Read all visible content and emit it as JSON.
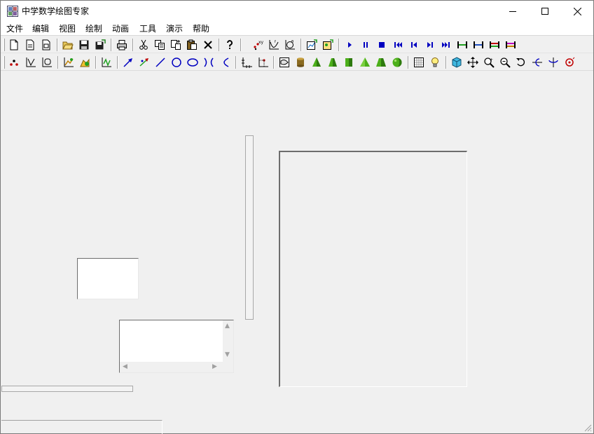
{
  "window": {
    "title": "中学数学绘图专家",
    "minimize_icon": "minimize-icon",
    "maximize_icon": "maximize-icon",
    "close_icon": "close-icon"
  },
  "menu": {
    "items": [
      "文件",
      "编辑",
      "视图",
      "绘制",
      "动画",
      "工具",
      "演示",
      "帮助"
    ]
  },
  "toolbar_top": {
    "icons": [
      "new-icon",
      "new-page-icon",
      "copy-page-icon",
      "open-folder-icon",
      "save-icon",
      "save-as-icon",
      "print-icon",
      "cut-icon",
      "copy-icon",
      "paste-special-icon",
      "paste-icon",
      "delete-icon",
      "help-icon",
      "point-coordinates-icon",
      "function-graph-icon",
      "polar-graph-icon",
      "insert-graph-icon",
      "insert-image-icon",
      "play-icon",
      "pause-icon",
      "stop-icon",
      "first-frame-icon",
      "previous-frame-icon",
      "next-frame-icon",
      "last-frame-icon",
      "interval-a-icon",
      "interval-b-icon",
      "interval-c-icon",
      "interval-d-icon"
    ]
  },
  "toolbar_draw": {
    "icons": [
      "points-icon",
      "axes-icon",
      "axes-box-icon",
      "function-plot-icon",
      "function-area-icon",
      "select-graph-icon",
      "vector-arrow-icon",
      "color-vector-icon",
      "line-segment-icon",
      "circle-icon",
      "ellipse-icon",
      "hyperbola-icon",
      "parabola-icon",
      "coordinate-axes-icon",
      "point-axes-icon",
      "surface-box-icon",
      "cylinder-icon",
      "cone-icon",
      "frustum-icon",
      "prism-icon",
      "pyramid-icon",
      "truncated-pyramid-icon",
      "sphere-icon",
      "grid-icon",
      "light-bulb-icon",
      "cube-view-icon",
      "move-icon",
      "zoom-in-icon",
      "zoom-out-icon",
      "rotate-icon",
      "rotate-x-icon",
      "rotate-y-icon",
      "rotate-z-icon"
    ]
  },
  "colors": {
    "accent_blue": "#0000c0",
    "titlebar_bg": "#ffffff",
    "client_bg": "#f0f0f0",
    "solid_green": "#4caf1a"
  }
}
